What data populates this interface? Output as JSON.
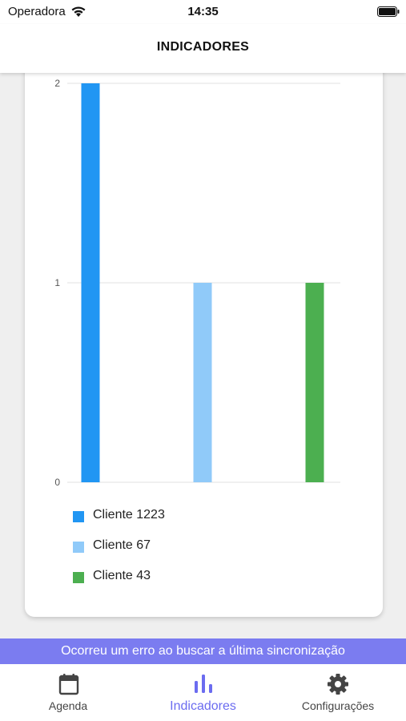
{
  "status_bar": {
    "carrier": "Operadora",
    "time": "14:35",
    "icons": [
      "wifi-icon",
      "battery-icon"
    ]
  },
  "header": {
    "title": "INDICADORES"
  },
  "chart_data": {
    "type": "bar",
    "categories": [
      "Cliente 1223",
      "Cliente 67",
      "Cliente 43"
    ],
    "values": [
      2,
      1,
      1
    ],
    "colors": [
      "#2196f3",
      "#90caf9",
      "#4caf50"
    ],
    "ylim": [
      0,
      2
    ],
    "yticks": [
      "0",
      "1",
      "2"
    ],
    "grid": true,
    "legend_position": "bottom"
  },
  "legend": {
    "items": [
      {
        "label": "Cliente 1223",
        "color": "#2196f3"
      },
      {
        "label": "Cliente 67",
        "color": "#90caf9"
      },
      {
        "label": "Cliente 43",
        "color": "#4caf50"
      }
    ]
  },
  "banner": {
    "message": "Ocorreu um erro ao buscar a última sincronização",
    "color": "#7b7cf0"
  },
  "tab_bar": {
    "tabs": [
      {
        "label": "Agenda",
        "icon": "calendar-icon",
        "active": false
      },
      {
        "label": "Indicadores",
        "icon": "bar-chart-icon",
        "active": true
      },
      {
        "label": "Configurações",
        "icon": "gear-icon",
        "active": false
      }
    ],
    "active_color": "#6b6cf0"
  }
}
